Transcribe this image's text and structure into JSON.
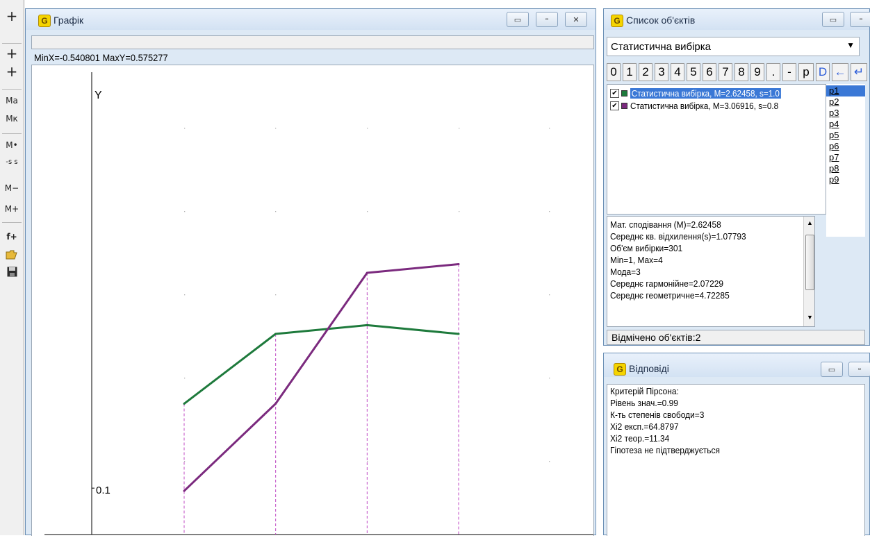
{
  "toolbar": {
    "buttons": [
      "+",
      "+",
      "+",
      "Ma",
      "Mк",
      "M•",
      "-s s",
      "M−",
      "M+",
      "f+"
    ]
  },
  "graph_window": {
    "title": "Графік",
    "status": "MinX=-0.540801  MaxY=0.575277",
    "min_label": "▭",
    "max_label": "▫",
    "close_label": "✕"
  },
  "chart_data": {
    "type": "line",
    "x": [
      1,
      2,
      3,
      4
    ],
    "y_axis_label": "Y",
    "y_tick_labels": [
      "0.1"
    ],
    "ylim": [
      0.05,
      0.58
    ],
    "xlim": [
      0.8,
      4.2
    ],
    "series": [
      {
        "values": [
          0.2,
          0.28,
          0.29,
          0.28
        ],
        "color": "#1e7a3c"
      },
      {
        "values": [
          0.1,
          0.2,
          0.35,
          0.36
        ],
        "color": "#7b2a7e"
      }
    ],
    "grid": "dotted"
  },
  "objects_window": {
    "title": "Список об'єктів",
    "dropdown_value": "Статистична вибірка",
    "keys": [
      "0",
      "1",
      "2",
      "3",
      "4",
      "5",
      "6",
      "7",
      "8",
      "9",
      ".",
      "-",
      "p",
      "D",
      "←",
      "↵"
    ],
    "items": [
      {
        "label": "Статистична вибірка, M=2.62458, s=1.0",
        "color": "#1e7a3c",
        "checked": "✔",
        "selected": true
      },
      {
        "label": "Статистична вибірка, M=3.06916, s=0.8",
        "color": "#7b2a7e",
        "checked": "✔",
        "selected": false
      }
    ],
    "params": [
      "p1",
      "p2",
      "p3",
      "p4",
      "p5",
      "p6",
      "p7",
      "p8",
      "p9"
    ],
    "info": [
      "Мат. сподівання (М)=2.62458",
      "Середнє кв. відхилення(s)=1.07793",
      "Об'єм вибірки=301",
      "Min=1, Max=4",
      "Мода=3",
      "Середнє гармонійне=2.07229",
      "Середнє геометричне=4.72285"
    ],
    "status": "Відмічено об'єктів:2"
  },
  "answers_window": {
    "title": "Відповіді",
    "lines": [
      "Критерій Пірсона:",
      "Рівень знач.=0.99",
      "К-ть степенів свободи=3",
      "Xi2 експ.=64.8797",
      "Xi2 теор.=11.34",
      "Гіпотеза не підтверджується"
    ]
  }
}
